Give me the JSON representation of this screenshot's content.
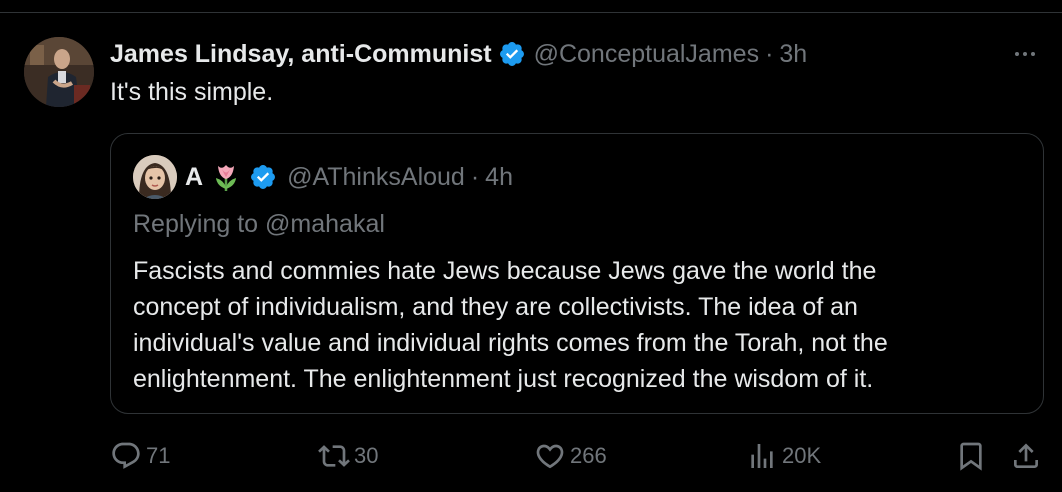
{
  "tweet": {
    "display_name": "James Lindsay, anti-Communist",
    "handle": "@ConceptualJames",
    "separator": "·",
    "time": "3h",
    "text": "It's this simple."
  },
  "quoted_tweet": {
    "display_name": "A",
    "handle": "@AThinksAloud",
    "separator": "·",
    "time": "4h",
    "replying_prefix": "Replying to",
    "replying_to": "@mahakal",
    "body_lines": [
      "Fascists and commies hate Jews because Jews gave the world the",
      "concept of individualism, and they are collectivists. The idea of an",
      "individual's value and individual rights comes from the Torah, not the",
      "enlightenment. The enlightenment just recognized the wisdom of it."
    ]
  },
  "actions": {
    "replies": "71",
    "reposts": "30",
    "likes": "266",
    "views": "20K"
  },
  "icons": {
    "verified": "verified-badge-icon",
    "tulip": "tulip-emoji-icon",
    "more": "more-icon",
    "reply": "reply-icon",
    "repost": "repost-icon",
    "like": "heart-icon",
    "views": "views-icon",
    "bookmark": "bookmark-icon",
    "share": "share-icon"
  },
  "colors": {
    "background": "#000000",
    "text_primary": "#e7e9ea",
    "text_secondary": "#71767b",
    "border": "#2f3336",
    "verified_blue": "#1d9bf0"
  }
}
